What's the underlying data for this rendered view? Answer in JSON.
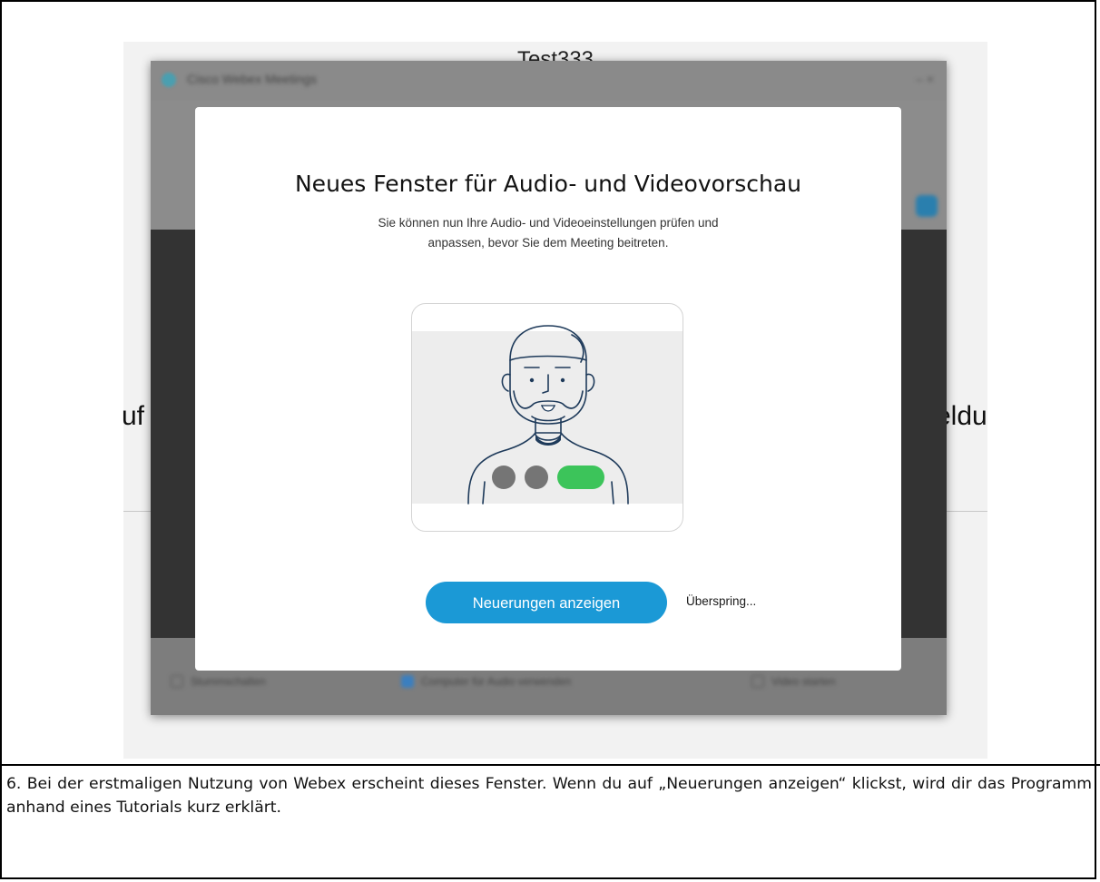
{
  "background_app": {
    "meeting_title": "Test333",
    "side_text_left": "uf",
    "side_text_right": "eldu",
    "window_title": "Cisco Webex Meetings",
    "window_controls": "–   ×",
    "bottom_left_label": "Stummschalten",
    "bottom_center_label": "Computer für Audio verwenden",
    "bottom_right_label": "Video starten"
  },
  "modal": {
    "title": "Neues Fenster für Audio- und Videovorschau",
    "description_line1": "Sie können nun Ihre Audio- und Videoeinstellungen prüfen und",
    "description_line2": "anpassen, bevor Sie dem Meeting beitreten.",
    "primary_button": "Neuerungen anzeigen",
    "skip_label": "Überspring..."
  },
  "caption": {
    "text": "6. Bei der erstmaligen Nutzung von Webex erscheint dieses Fenster. Wenn du auf „Neuerungen anzeigen“ klickst, wird dir das Programm anhand eines Tutorials kurz erklärt."
  },
  "colors": {
    "primary_button": "#1b99d6",
    "toggle_on": "#3cc45a",
    "illustration_stroke": "#1e3a5a",
    "overlay_app": "#3d3d3d"
  }
}
